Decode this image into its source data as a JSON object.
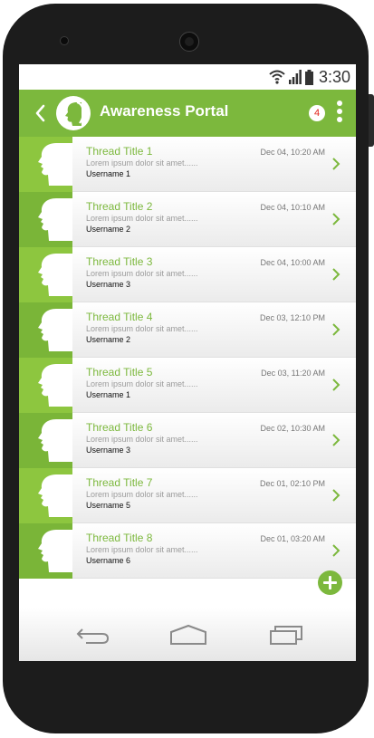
{
  "status_bar": {
    "time": "3:30",
    "icons": [
      "wifi-icon",
      "signal-icon",
      "battery-icon"
    ]
  },
  "app_bar": {
    "title": "Awareness Portal",
    "notification_count": "4"
  },
  "colors": {
    "accent": "#7cb83d",
    "badge_text": "#e2231a"
  },
  "threads": [
    {
      "title": "Thread Title 1",
      "snippet": "Lorem ipsum dolor sit amet......",
      "user": "Username 1",
      "date": "Dec 04, 10:20 AM"
    },
    {
      "title": "Thread Title 2",
      "snippet": "Lorem ipsum dolor sit amet......",
      "user": "Username 2",
      "date": "Dec 04, 10:10 AM"
    },
    {
      "title": "Thread Title 3",
      "snippet": "Lorem ipsum dolor sit amet......",
      "user": "Username 3",
      "date": "Dec 04, 10:00 AM"
    },
    {
      "title": "Thread Title 4",
      "snippet": "Lorem ipsum dolor sit amet......",
      "user": "Username 2",
      "date": "Dec 03, 12:10 PM"
    },
    {
      "title": "Thread Title 5",
      "snippet": "Lorem ipsum dolor sit amet......",
      "user": "Username 1",
      "date": "Dec 03, 11:20 AM"
    },
    {
      "title": "Thread Title 6",
      "snippet": "Lorem ipsum dolor sit amet......",
      "user": "Username 3",
      "date": "Dec 02, 10:30 AM"
    },
    {
      "title": "Thread Title 7",
      "snippet": "Lorem ipsum dolor sit amet......",
      "user": "Username 5",
      "date": "Dec 01, 02:10 PM"
    },
    {
      "title": "Thread Title 8",
      "snippet": "Lorem ipsum dolor sit amet......",
      "user": "Username 6",
      "date": "Dec 01, 03:20 AM"
    }
  ]
}
